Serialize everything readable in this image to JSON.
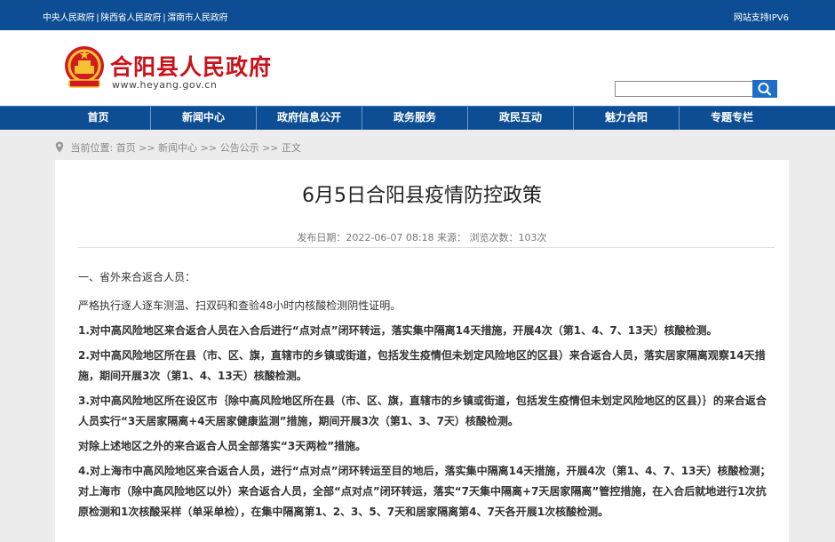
{
  "topbar": {
    "links": [
      "中央人民政府",
      "陕西省人民政府",
      "渭南市人民政府"
    ],
    "separator": "|",
    "ipv6": "网站支持IPV6"
  },
  "header": {
    "site_title": "合阳县人民政府",
    "site_url": "www.heyang.gov.cn",
    "search": {
      "value": "",
      "placeholder": ""
    },
    "icons": {
      "emblem": "national-emblem-icon",
      "search": "search-icon"
    },
    "colors": {
      "title": "#c8121a",
      "bar": "#0c4d93"
    }
  },
  "nav": {
    "items": [
      "首页",
      "新闻中心",
      "政府信息公开",
      "政务服务",
      "政民互动",
      "魅力合阳",
      "专题专栏"
    ]
  },
  "breadcrumb": {
    "prefix": "当前位置:",
    "items": [
      "首页",
      "新闻中心",
      "公告公示",
      "正文"
    ],
    "separator": ">>"
  },
  "article": {
    "title": "6月5日合阳县疫情防控政策",
    "meta": "发布日期：2022-06-07 08:18 来源：   浏览次数：103次",
    "paragraphs": [
      "一、省外来合返合人员：",
      "严格执行逐人逐车测温、扫双码和查验48小时内核酸检测阴性证明。",
      "1.对中高风险地区来合返合人员在入合后进行“点对点”闭环转运，落实集中隔离14天措施，开展4次（第1、4、7、13天）核酸检测。",
      "2.对中高风险地区所在县（市、区、旗，直辖市的乡镇或街道，包括发生疫情但未划定风险地区的区县）来合返合人员，落实居家隔离观察14天措施，期间开展3次（第1、4、13天）核酸检测。",
      "3.对中高风险地区所在设区市｛除中高风险地区所在县（市、区、旗，直辖市的乡镇或街道，包括发生疫情但未划定风险地区的区县）｝的来合返合人员实行“3天居家隔离+4天居家健康监测”措施，期间开展3次（第1、3、7天）核酸检测。",
      "对除上述地区之外的来合返合人员全部落实“3天两检”措施。",
      "4.对上海市中高风险地区来合返合人员，进行“点对点”闭环转运至目的地后，落实集中隔离14天措施，开展4次（第1、4、7、13天）核酸检测；对上海市（除中高风险地区以外）来合返合人员，全部“点对点”闭环转运，落实“7天集中隔离+7天居家隔离”管控措施，在入合后就地进行1次抗原检测和1次核酸采样（单采单检），在集中隔离第1、2、3、5、7天和居家隔离第4、7天各开展1次核酸检测。"
    ]
  }
}
